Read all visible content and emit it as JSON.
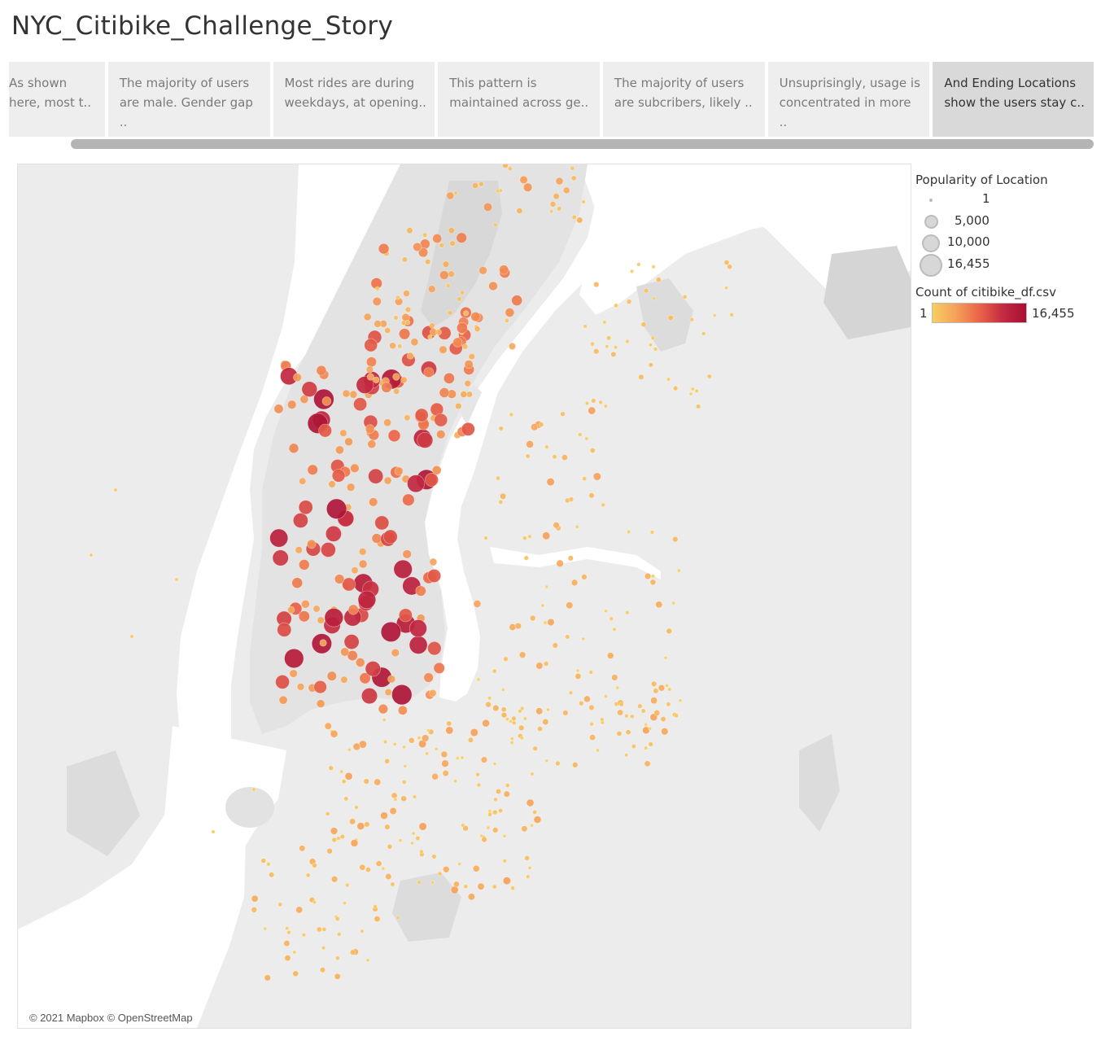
{
  "title": "NYC_Citibike_Challenge_Story",
  "story_points": [
    {
      "label": "As shown\nhere, most t.."
    },
    {
      "label": "The majority of users\nare male. Gender gap .."
    },
    {
      "label": "Most rides are during\nweekdays, at opening.."
    },
    {
      "label": "This pattern is\nmaintained across ge.."
    },
    {
      "label": "The majority of users\nare subcribers, likely .."
    },
    {
      "label": "Unsuprisingly, usage is\nconcentrated in more .."
    },
    {
      "label": "And Ending Locations\nshow the users stay c.."
    }
  ],
  "active_story_point": 6,
  "map": {
    "attribution": "© 2021 Mapbox © OpenStreetMap",
    "colors": {
      "water": "#ffffff",
      "land": "#ececec",
      "park": "#dedede",
      "manhattan": "#e3e3e3"
    }
  },
  "legend": {
    "size_title": "Popularity of Location",
    "size_items": [
      {
        "label": "1"
      },
      {
        "label": "5,000"
      },
      {
        "label": "10,000"
      },
      {
        "label": "16,455"
      }
    ],
    "color_title": "Count of citibike_df.csv",
    "color_min": "1",
    "color_max": "16,455",
    "color_ramp": [
      "#f7cf62",
      "#f5a05a",
      "#ea6448",
      "#c42a41",
      "#a80f33"
    ]
  }
}
